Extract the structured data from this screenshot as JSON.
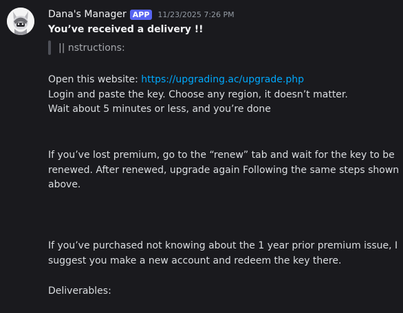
{
  "message": {
    "author": "Dana's Manager",
    "badge": "APP",
    "timestamp": "11/23/2025 7:26 PM",
    "title": "You’ve received a delivery !!",
    "quote": "|| nstructions:",
    "open_prefix": "Open this website: ",
    "link_url": "https://upgrading.ac/upgrade.php",
    "line_login": "Login and paste the key. Choose any region, it doesn’t matter.",
    "line_wait": "Wait about 5 minutes or less, and you’re done",
    "lost_line1": "If you’ve lost premium, go to the “renew” tab and wait for the key to be",
    "lost_line2": "renewed. After renewed, upgrade again Following the same steps shown",
    "lost_line3": "above.",
    "purchased_line1": "If you’ve purchased not knowing about the 1 year prior premium issue, I",
    "purchased_line2": "suggest you make a new account and redeem the key there.",
    "deliverables": "Deliverables:"
  }
}
